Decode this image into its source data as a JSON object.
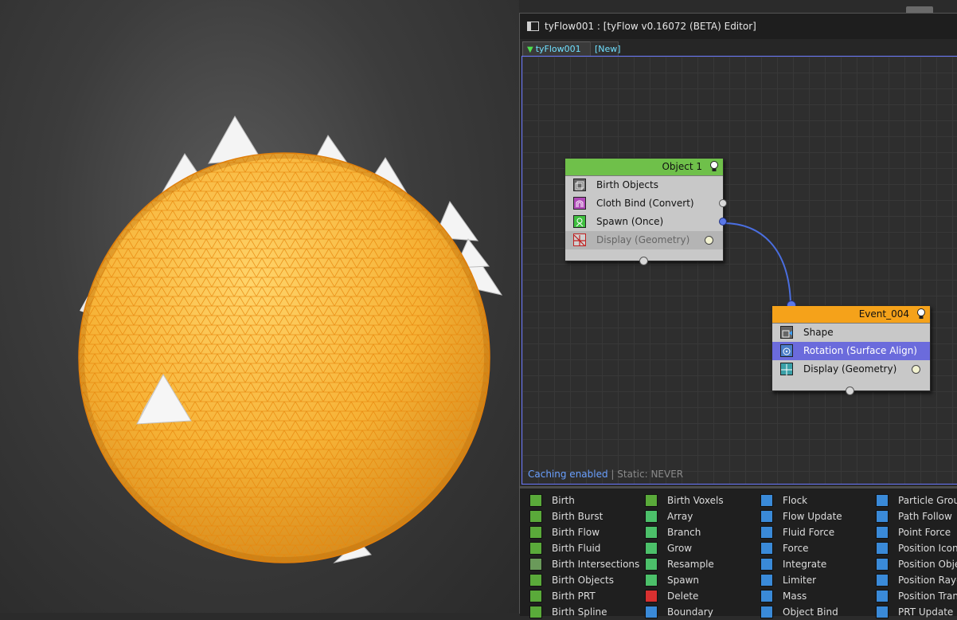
{
  "window": {
    "title": "tyFlow001 : [tyFlow v0.16072 (BETA) Editor]"
  },
  "tabs": [
    {
      "label": "tyFlow001"
    },
    {
      "label": "[New]"
    }
  ],
  "nodes": {
    "object1": {
      "title": "Object 1",
      "header_color": "#6fc04a",
      "operators": [
        {
          "label": "Birth Objects",
          "icon": "birth-objects-icon"
        },
        {
          "label": "Cloth Bind (Convert)",
          "icon": "cloth-bind-icon"
        },
        {
          "label": "Spawn (Once)",
          "icon": "spawn-icon"
        },
        {
          "label": "Display (Geometry)",
          "icon": "display-disabled-icon"
        }
      ]
    },
    "event004": {
      "title": "Event_004",
      "header_color": "#f5a21a",
      "operators": [
        {
          "label": "Shape",
          "icon": "shape-icon"
        },
        {
          "label": "Rotation (Surface Align)",
          "icon": "rotation-icon"
        },
        {
          "label": "Display (Geometry)",
          "icon": "display-icon"
        }
      ]
    }
  },
  "status": {
    "caching": "Caching enabled",
    "static": " | Static: NEVER"
  },
  "depot": {
    "col1": [
      "Birth",
      "Birth Burst",
      "Birth Flow",
      "Birth Fluid",
      "Birth Intersections",
      "Birth Objects",
      "Birth PRT",
      "Birth Spline"
    ],
    "col2": [
      "Birth Voxels",
      "Array",
      "Branch",
      "Grow",
      "Resample",
      "Spawn",
      "Delete",
      "Boundary"
    ],
    "col3": [
      "Flock",
      "Flow Update",
      "Fluid Force",
      "Force",
      "Integrate",
      "Limiter",
      "Mass",
      "Object Bind"
    ],
    "col4": [
      "Particle Groups",
      "Path Follow",
      "Point Force",
      "Position Icon",
      "Position Object",
      "Position Raycast",
      "Position Transfer",
      "PRT Update"
    ]
  },
  "colors": {
    "sphere": "#f5a623",
    "selected_op": "#6b6bdc",
    "canvas_border": "#6a78ff"
  }
}
